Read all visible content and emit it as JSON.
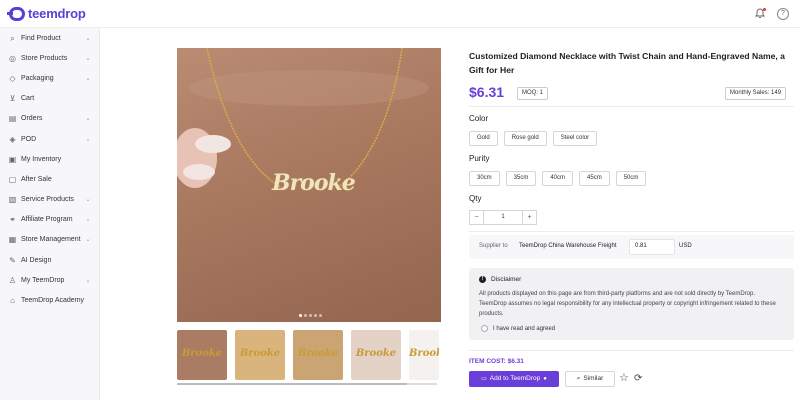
{
  "app": {
    "logo_text": "teemdrop"
  },
  "topbar": {
    "notification_icon": "bell-icon",
    "help_icon": "help-icon",
    "help_glyph": "?"
  },
  "sidebar": {
    "items": [
      {
        "label": "Find Product",
        "icon": "search-icon",
        "glyph": "⌕",
        "has_chevron": true
      },
      {
        "label": "Store Products",
        "icon": "globe-icon",
        "glyph": "◎",
        "has_chevron": true
      },
      {
        "label": "Packaging",
        "icon": "package-icon",
        "glyph": "◇",
        "has_chevron": true
      },
      {
        "label": "Cart",
        "icon": "cart-icon",
        "glyph": "⊻",
        "has_chevron": false
      },
      {
        "label": "Orders",
        "icon": "orders-icon",
        "glyph": "▤",
        "has_chevron": true
      },
      {
        "label": "POD",
        "icon": "pod-icon",
        "glyph": "◈",
        "has_chevron": true
      },
      {
        "label": "My Inventory",
        "icon": "inventory-icon",
        "glyph": "▣",
        "has_chevron": false
      },
      {
        "label": "After Sale",
        "icon": "after-sale-icon",
        "glyph": "▢",
        "has_chevron": false
      },
      {
        "label": "Service Products",
        "icon": "service-icon",
        "glyph": "▧",
        "has_chevron": true
      },
      {
        "label": "Affiliate Program",
        "icon": "affiliate-icon",
        "glyph": "⚭",
        "has_chevron": true
      },
      {
        "label": "Store Management",
        "icon": "store-icon",
        "glyph": "▦",
        "has_chevron": true
      },
      {
        "label": "AI Design",
        "icon": "ai-design-icon",
        "glyph": "✎",
        "has_chevron": false
      },
      {
        "label": "My TeemDrop",
        "icon": "user-icon",
        "glyph": "♙",
        "has_chevron": true
      },
      {
        "label": "TeemDrop Academy",
        "icon": "academy-icon",
        "glyph": "⌂",
        "has_chevron": false
      }
    ]
  },
  "product": {
    "main_image_text": "Brooke",
    "thumbnails": [
      "Brooke",
      "Brooke",
      "Brooke",
      "Brooke",
      "Brooke"
    ],
    "title": "Customized Diamond Necklace with Twist Chain and Hand-Engraved Name, a Gift for Her",
    "price": "$6.31",
    "moq": "MOQ: 1",
    "monthly_sales": "Monthly Sales: 149",
    "color_label": "Color",
    "colors": [
      "Gold",
      "Rose gold",
      "Steel color"
    ],
    "purity_label": "Purity",
    "purities": [
      "30cm",
      "35cm",
      "40cm",
      "45cm",
      "50cm"
    ],
    "qty_label": "Qty",
    "qty_value": "1",
    "qty_minus": "−",
    "qty_plus": "+"
  },
  "supplier": {
    "label": "Supplier to",
    "name": "TeemDrop China Warehouse Freight",
    "price": "0.81",
    "currency": "USD"
  },
  "disclaimer": {
    "icon_glyph": "!",
    "title": "Disclaimer",
    "text": "All products displayed on this page are from third-party platforms and are not sold directly by TeemDrop. TeemDrop assumes no legal responsibility for any intellectual property or copyright infringement related to these products.",
    "checkbox_label": "I have read and agreed"
  },
  "actions": {
    "item_cost": "ITEM COST:  $6.31",
    "add_label": "Add to TeemDrop",
    "similar_label": "Similar",
    "add_icon_glyph": "▭",
    "info_glyph": "●",
    "search_glyph": "⌕",
    "star_glyph": "☆",
    "refresh_glyph": "⟳"
  },
  "colors": {
    "accent": "#6a3ed8",
    "brand": "#5b3fd6"
  }
}
